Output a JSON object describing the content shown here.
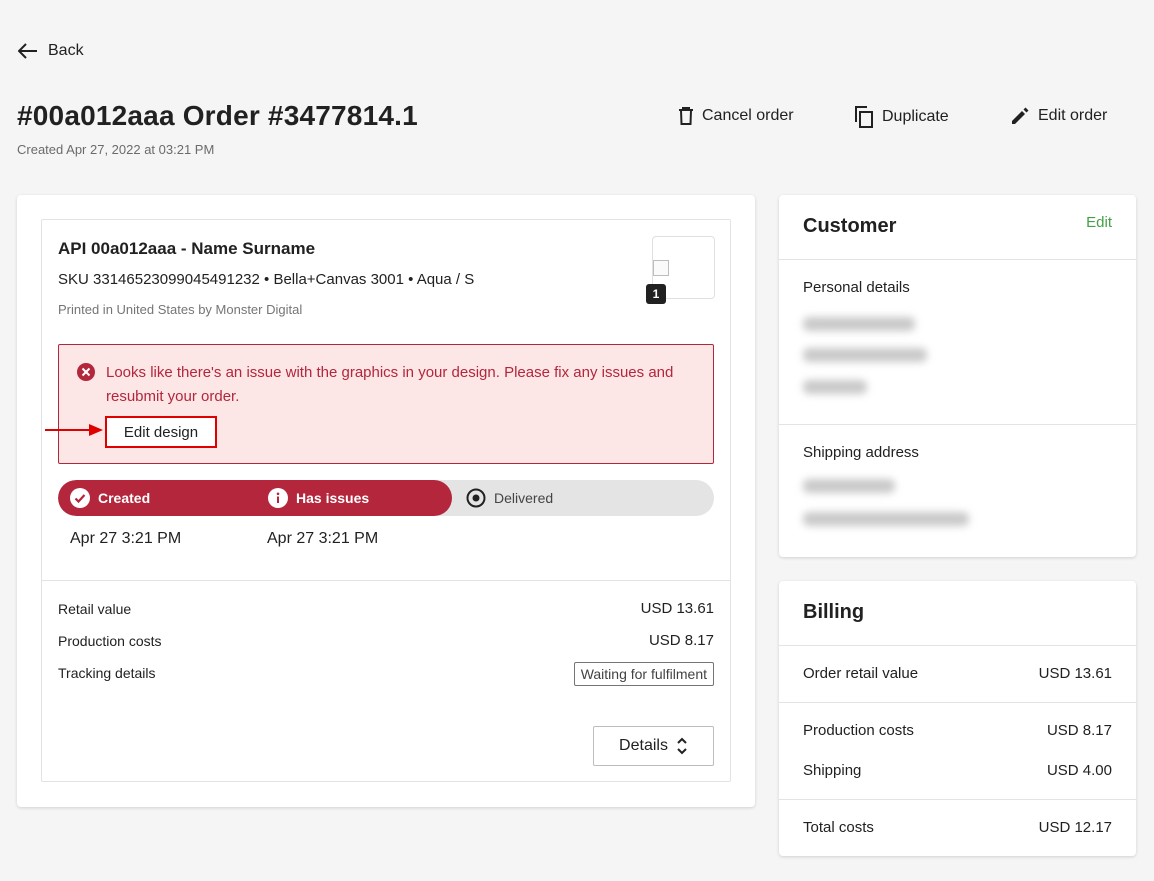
{
  "header": {
    "back_label": "Back",
    "title": "#00a012aaa Order #3477814.1",
    "created": "Created Apr 27, 2022 at 03:21 PM",
    "actions": {
      "cancel_label": "Cancel order",
      "duplicate_label": "Duplicate",
      "edit_label": "Edit order"
    }
  },
  "item": {
    "title": "API 00a012aaa - Name Surname",
    "sku": "SKU 3314652309904549​1232  • Bella+Canvas 3001 • Aqua / S",
    "printed": "Printed in United States by Monster Digital",
    "quantity": "1"
  },
  "alert": {
    "message": "Looks like there's an issue with the graphics in your design. Please fix any issues and resubmit your order.",
    "edit_design_label": "Edit design"
  },
  "tracker": {
    "steps": [
      {
        "label": "Created",
        "date": "Apr 27 3:21 PM"
      },
      {
        "label": "Has issues",
        "date": "Apr 27 3:21 PM"
      },
      {
        "label": "Delivered",
        "date": ""
      }
    ],
    "progress_fraction": 0.6
  },
  "summary": {
    "retail_label": "Retail value",
    "retail_value": "USD 13.61",
    "production_label": "Production costs",
    "production_value": "USD 8.17",
    "tracking_label": "Tracking details",
    "tracking_value": "Waiting for fulfilment",
    "details_label": "Details"
  },
  "customer": {
    "title": "Customer",
    "edit_label": "Edit",
    "personal_label": "Personal details",
    "shipping_label": "Shipping address"
  },
  "billing": {
    "title": "Billing",
    "order_retail_label": "Order retail value",
    "order_retail_value": "USD 13.61",
    "production_label": "Production costs",
    "production_value": "USD 8.17",
    "shipping_label": "Shipping",
    "shipping_value": "USD 4.00",
    "total_label": "Total costs",
    "total_value": "USD 12.17"
  },
  "colors": {
    "accent": "#b3263c",
    "alert_bg": "#fde6e6",
    "link_green": "#43a047",
    "highlight_red": "#e00000"
  }
}
